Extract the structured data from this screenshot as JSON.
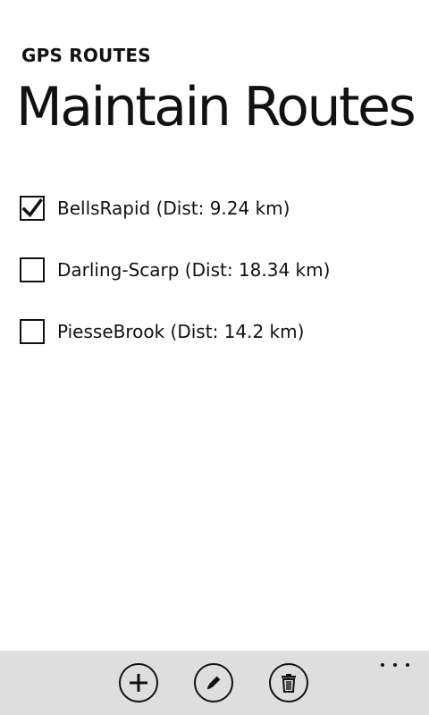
{
  "header": {
    "app_title": "GPS ROUTES",
    "page_title": "Maintain Routes"
  },
  "routes": [
    {
      "label": "BellsRapid (Dist: 9.24 km)",
      "checked": true
    },
    {
      "label": "Darling-Scarp (Dist: 18.34 km)",
      "checked": false
    },
    {
      "label": "PiesseBrook (Dist: 14.2 km)",
      "checked": false
    }
  ],
  "app_bar": {
    "buttons": [
      {
        "icon": "add-icon",
        "action": "add"
      },
      {
        "icon": "edit-icon",
        "action": "edit"
      },
      {
        "icon": "delete-icon",
        "action": "delete"
      }
    ],
    "more_icon": "ellipsis-icon"
  },
  "colors": {
    "background": "#ffffff",
    "foreground": "#111111",
    "app_bar": "#dedede"
  }
}
